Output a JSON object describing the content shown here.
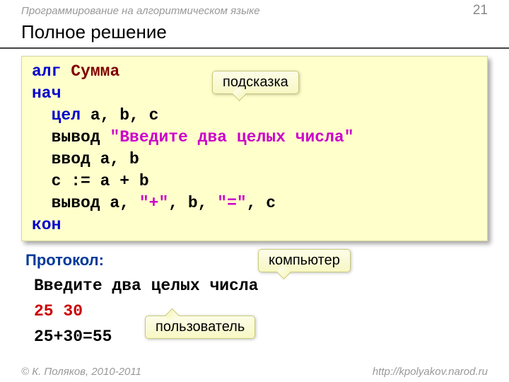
{
  "header": {
    "course": "Программирование на алгоритмическом языке",
    "page": "21"
  },
  "title": "Полное решение",
  "code": {
    "l1_alg": "алг",
    "l1_name": "Сумма",
    "l2": "нач",
    "l3_type": "цел",
    "l3_vars": " a, b, c",
    "l4_out": "вывод ",
    "l4_str": "\"Введите два целых числа\"",
    "l5": "ввод a, b",
    "l6": "c := a + b",
    "l7_out": "вывод a, ",
    "l7_s1": "\"+\"",
    "l7_mid": ", b, ",
    "l7_s2": "\"=\"",
    "l7_end": ", c",
    "l8": "кон"
  },
  "protocol": {
    "label": "Протокол:",
    "line1": "Введите два целых числа",
    "line2": "25 30",
    "line3": "25+30=55"
  },
  "callouts": {
    "hint": "подсказка",
    "computer": "компьютер",
    "user": "пользователь"
  },
  "footer": {
    "copyright": "© К. Поляков, 2010-2011",
    "url": "http://kpolyakov.narod.ru"
  }
}
